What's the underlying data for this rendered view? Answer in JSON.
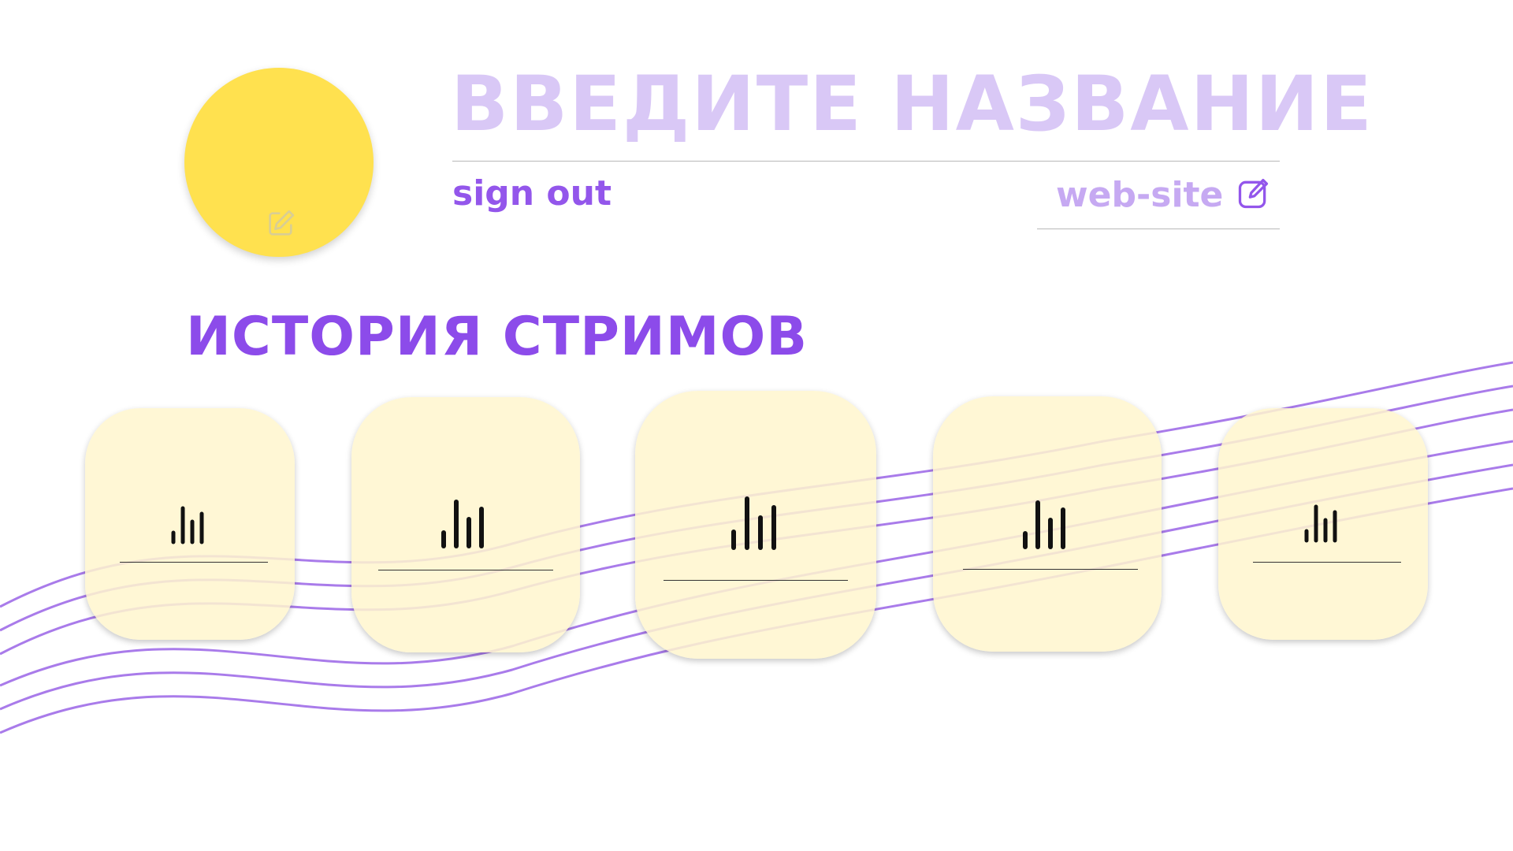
{
  "header": {
    "title": "ВВЕДИТЕ НАЗВАНИЕ",
    "sign_out": "sign out",
    "website_label": "web-site"
  },
  "section": {
    "title": "ИСТОРИЯ СТРИМОВ"
  },
  "streams": [
    {
      "icon": "equalizer-icon"
    },
    {
      "icon": "equalizer-icon"
    },
    {
      "icon": "equalizer-icon"
    },
    {
      "icon": "equalizer-icon"
    },
    {
      "icon": "equalizer-icon"
    }
  ],
  "colors": {
    "avatar": "#FFE14F",
    "title": "#D9C8F6",
    "accent": "#8C4BEA",
    "website": "#C6A9F2",
    "wave": "#A97BEA",
    "card": "#FFF6CE"
  },
  "icons": {
    "avatar_edit": "edit-icon",
    "website_edit": "edit-icon"
  }
}
